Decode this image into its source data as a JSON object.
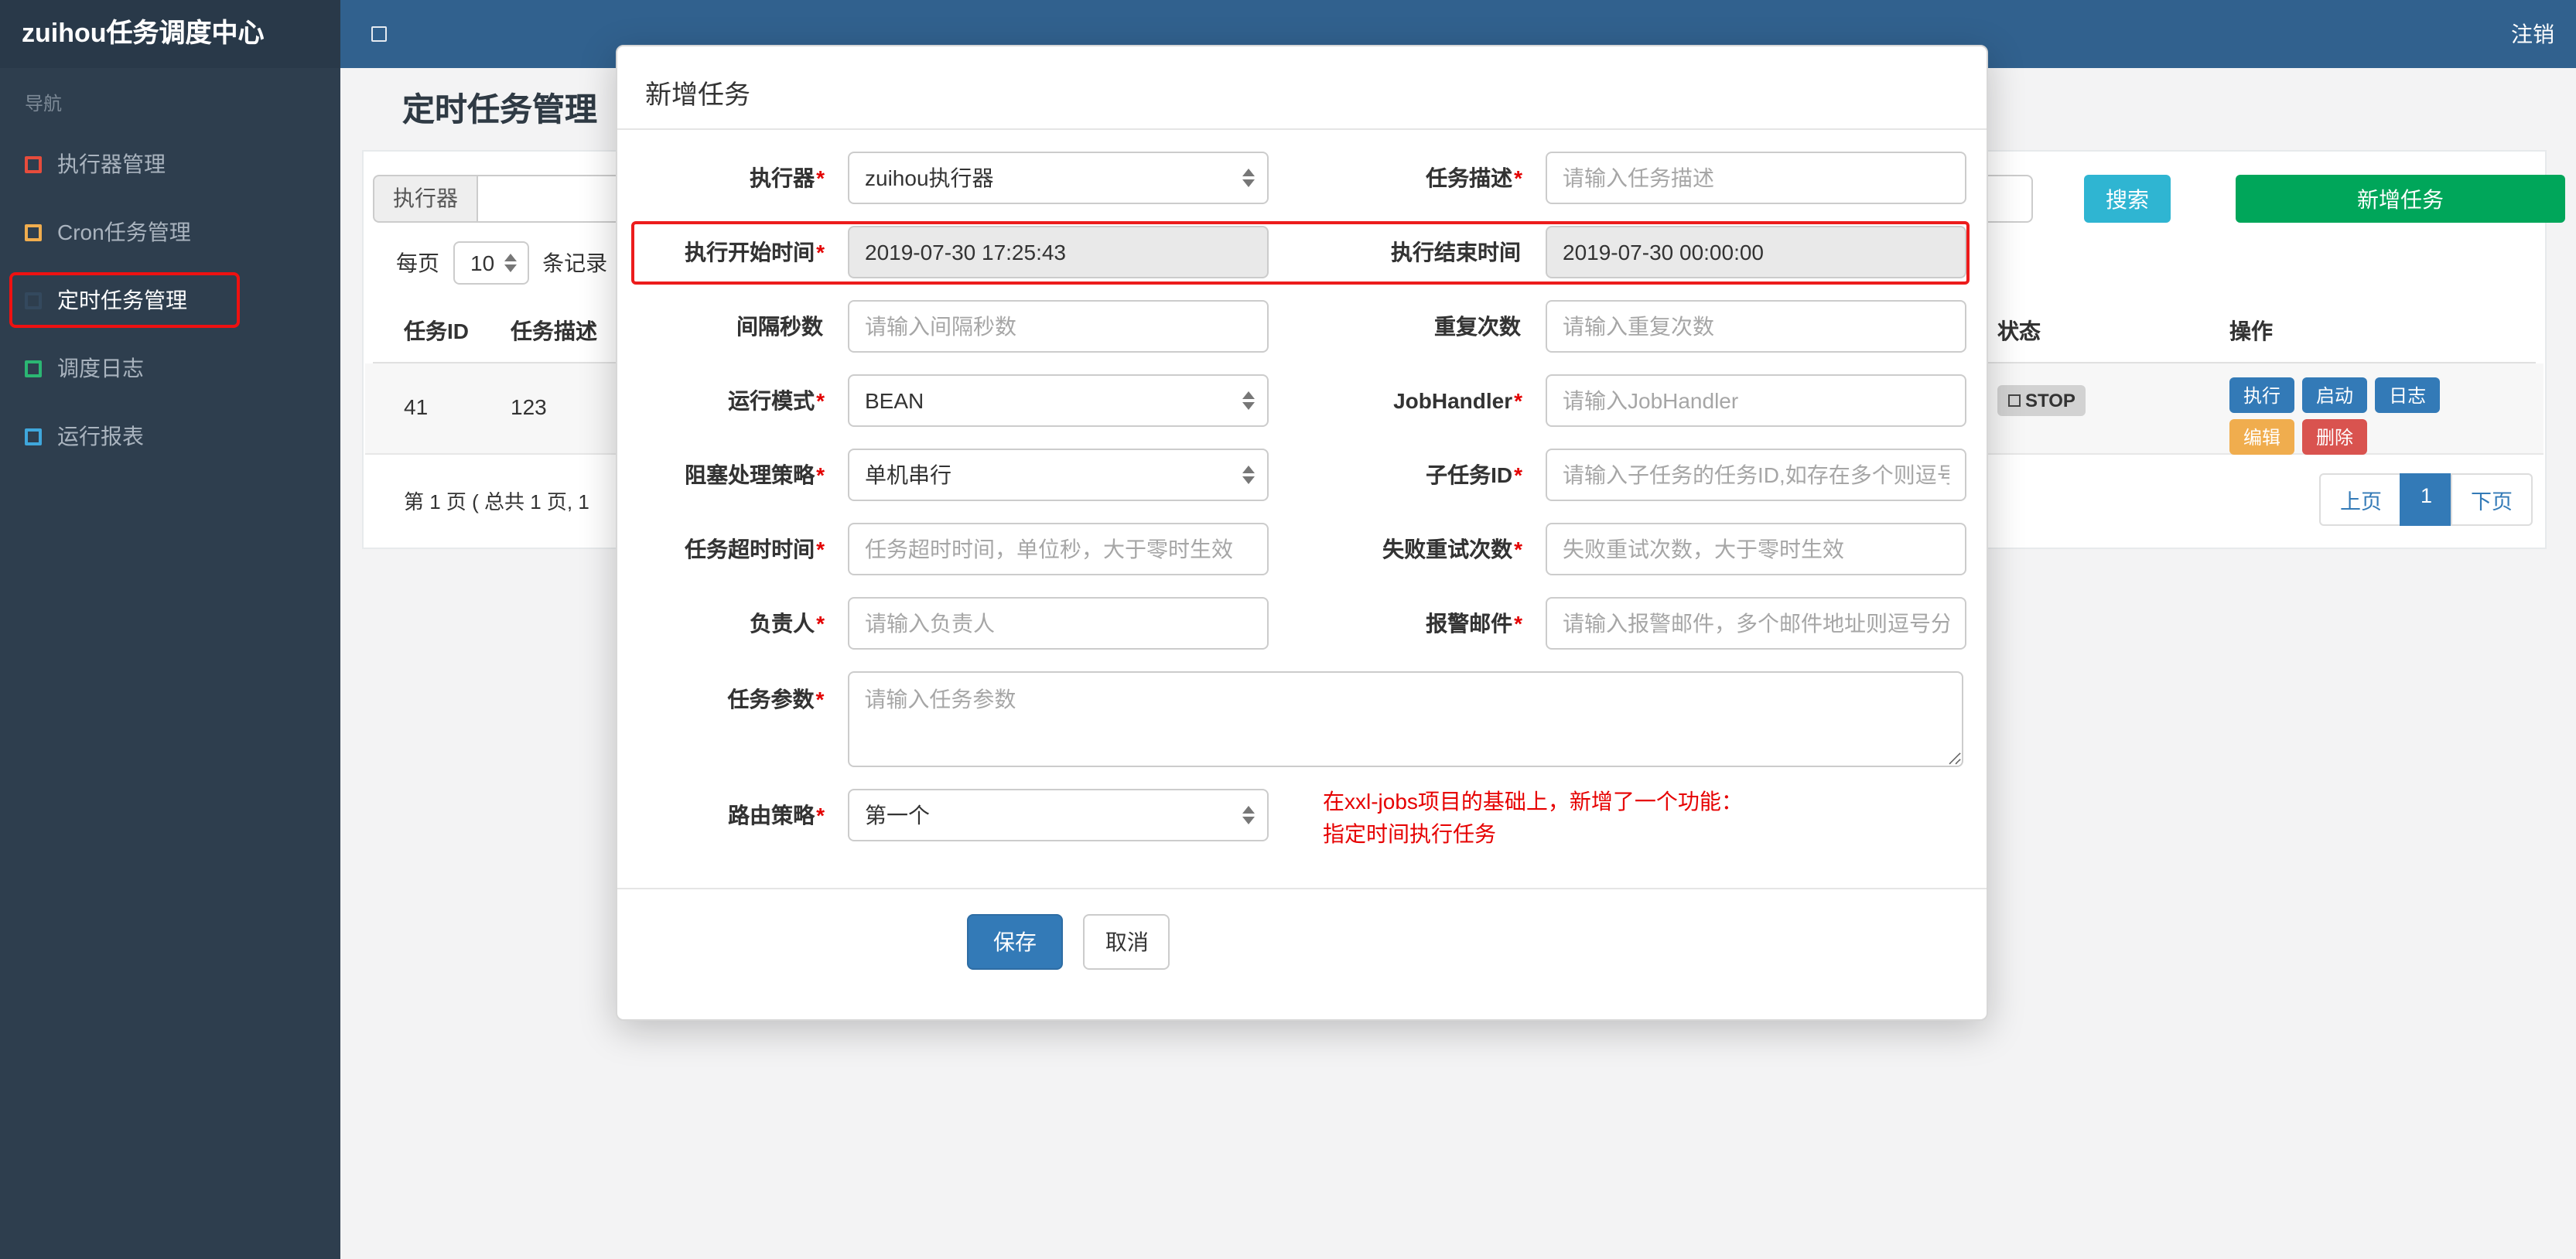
{
  "navbar": {
    "brand": "zuihou任务调度中心",
    "logout_label": "注销"
  },
  "sidebar": {
    "nav_label": "导航",
    "items": [
      {
        "label": "执行器管理",
        "icon": "red-square-icon",
        "icon_color": "#e74c3c"
      },
      {
        "label": "Cron任务管理",
        "icon": "orange-square-icon",
        "icon_color": "#f0ad4e"
      },
      {
        "label": "定时任务管理",
        "icon": "dark-square-icon",
        "icon_color": "#34495e",
        "active": true,
        "annotated": true
      },
      {
        "label": "调度日志",
        "icon": "green-square-icon",
        "icon_color": "#2bb673"
      },
      {
        "label": "运行报表",
        "icon": "blue-square-icon",
        "icon_color": "#3fa7dc"
      }
    ]
  },
  "page": {
    "title": "定时任务管理",
    "filter": {
      "executor_addon": "执行器",
      "search_label": "搜索",
      "add_label": "新增任务"
    },
    "perpage": {
      "prefix": "每页",
      "value": "10",
      "suffix": "条记录"
    },
    "table": {
      "col_id": "任务ID",
      "col_desc": "任务描述",
      "col_status": "状态",
      "col_ops": "操作",
      "row": {
        "id": "41",
        "desc": "123",
        "status": "STOP",
        "op_run": "执行",
        "op_start": "启动",
        "op_log": "日志",
        "op_edit": "编辑",
        "op_delete": "删除"
      }
    },
    "pagination": {
      "summary": "第 1 页 ( 总共 1 页, 1",
      "prev": "上页",
      "page": "1",
      "next": "下页"
    }
  },
  "modal": {
    "title": "新增任务",
    "fields": {
      "executor": {
        "label": "执行器",
        "req": "*",
        "value": "zuihou执行器"
      },
      "desc": {
        "label": "任务描述",
        "req": "*",
        "placeholder": "请输入任务描述"
      },
      "start_time": {
        "label": "执行开始时间",
        "req": "*",
        "value": "2019-07-30 17:25:43"
      },
      "end_time": {
        "label": "执行结束时间",
        "value": "2019-07-30 00:00:00"
      },
      "interval": {
        "label": "间隔秒数",
        "placeholder": "请输入间隔秒数"
      },
      "repeat": {
        "label": "重复次数",
        "placeholder": "请输入重复次数"
      },
      "glue_type": {
        "label": "运行模式",
        "req": "*",
        "value": "BEAN"
      },
      "job_handler": {
        "label": "JobHandler",
        "req": "*",
        "placeholder": "请输入JobHandler"
      },
      "block_strategy": {
        "label": "阻塞处理策略",
        "req": "*",
        "value": "单机串行"
      },
      "child_job": {
        "label": "子任务ID",
        "req": "*",
        "placeholder": "请输入子任务的任务ID,如存在多个则逗号分隔"
      },
      "timeout": {
        "label": "任务超时时间",
        "req": "*",
        "placeholder": "任务超时时间，单位秒，大于零时生效"
      },
      "retry": {
        "label": "失败重试次数",
        "req": "*",
        "placeholder": "失败重试次数，大于零时生效"
      },
      "owner": {
        "label": "负责人",
        "req": "*",
        "placeholder": "请输入负责人"
      },
      "alarm_email": {
        "label": "报警邮件",
        "req": "*",
        "placeholder": "请输入报警邮件，多个邮件地址则逗号分隔"
      },
      "param": {
        "label": "任务参数",
        "req": "*",
        "placeholder": "请输入任务参数"
      },
      "route_strategy": {
        "label": "路由策略",
        "req": "*",
        "value": "第一个"
      }
    },
    "note_line1": "在xxl-jobs项目的基础上，新增了一个功能：",
    "note_line2": "指定时间执行任务",
    "save_label": "保存",
    "cancel_label": "取消"
  },
  "theme": {
    "navbar_blue": "#31618e",
    "brand_bg": "#293949",
    "sidebar_bg": "#2e3e4e",
    "primary_blue": "#337ab7",
    "success_green": "#00a65a",
    "info_teal": "#2fb5d2",
    "warning_orange": "#f0ad4e",
    "danger_red": "#d9534f",
    "annotation_red": "#ee1111"
  }
}
